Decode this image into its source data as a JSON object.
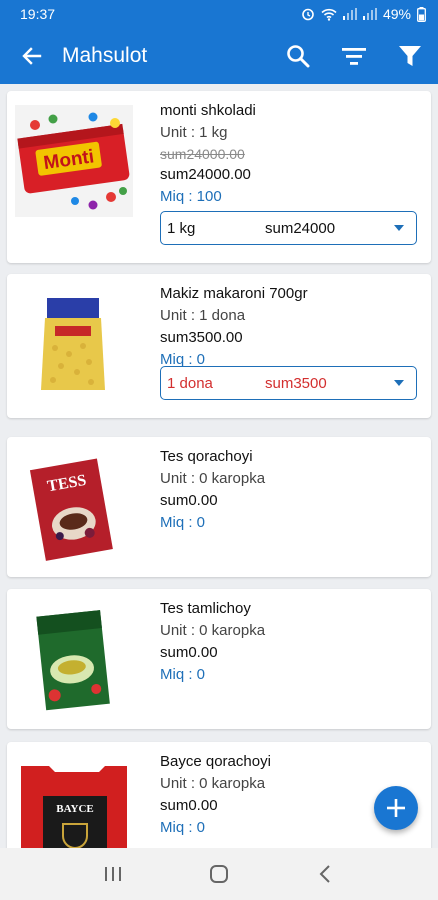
{
  "status_bar": {
    "time": "19:37",
    "battery": "49%"
  },
  "app_bar": {
    "title": "Mahsulot",
    "back_icon": "back-arrow-icon",
    "actions": [
      "search-icon",
      "sort-icon",
      "filter-icon"
    ]
  },
  "products": [
    {
      "name": "monti shkoladi",
      "unit": "Unit : 1 kg",
      "old_price": "sum24000.00",
      "price": "sum24000.00",
      "miq": "Miq : 100",
      "selector": {
        "unit": "1 kg",
        "price": "sum24000",
        "color": "#111111"
      }
    },
    {
      "name": "Makiz makaroni 700gr",
      "unit": "Unit : 1 dona",
      "price": "sum3500.00",
      "miq": "Miq : 0",
      "selector": {
        "unit": "1 dona",
        "price": "sum3500",
        "color": "#d32f2f"
      }
    },
    {
      "name": "Tes qorachoyi",
      "unit": "Unit : 0 karopka",
      "price": "sum0.00",
      "miq": "Miq : 0"
    },
    {
      "name": "Tes tamlichoy",
      "unit": "Unit : 0 karopka",
      "price": "sum0.00",
      "miq": "Miq : 0"
    },
    {
      "name": "Bayce qorachoyi",
      "unit": "Unit : 0 karopka",
      "price": "sum0.00",
      "miq": "Miq : 0"
    }
  ],
  "image_text": {
    "monti": "Monti",
    "tess": "TESS",
    "bayce": "BAYCE"
  },
  "colors": {
    "primary": "#1976d2",
    "link": "#1e6fb8",
    "error": "#d32f2f"
  },
  "fab_icon": "plus-icon",
  "nav_bar": [
    "recents-icon",
    "home-icon",
    "back-icon"
  ]
}
